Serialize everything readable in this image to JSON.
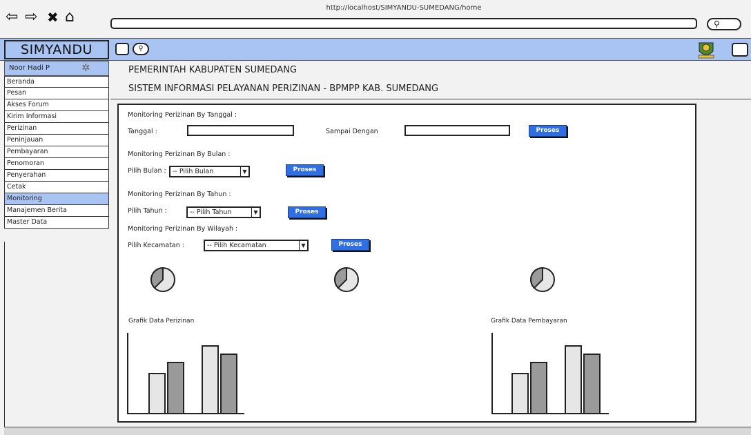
{
  "browser": {
    "url": "http://localhost/SIMYANDU-SUMEDANG/home",
    "back_icon": "arrow-left",
    "forward_icon": "arrow-right",
    "close_glyph": "✖",
    "home_icon": "home"
  },
  "app": {
    "brand": "SIMYANDU",
    "user": "Noor Hadi P",
    "header_line1": "PEMERINTAH KABUPATEN SUMEDANG",
    "header_line2": "SISTEM INFORMASI PELAYANAN PERIZINAN - BPMPP KAB. SUMEDANG",
    "accent_color": "#a9c4f2",
    "button_color": "#2f6ee3"
  },
  "sidebar": {
    "items": [
      {
        "label": "Beranda"
      },
      {
        "label": "Pesan"
      },
      {
        "label": "Akses Forum"
      },
      {
        "label": "Kirim Informasi"
      },
      {
        "label": "Perizinan"
      },
      {
        "label": "Peninjauan"
      },
      {
        "label": "Pembayaran"
      },
      {
        "label": "Penomoran"
      },
      {
        "label": "Penyerahan"
      },
      {
        "label": "Cetak"
      },
      {
        "label": "Monitoring",
        "active": true
      },
      {
        "label": "Manajemen Berita"
      },
      {
        "label": "Master Data"
      }
    ]
  },
  "monitoring": {
    "by_date": {
      "title": "Monitoring Perizinan By Tanggal :",
      "from_label": "Tanggal :",
      "from_value": "",
      "to_label": "Sampai Dengan",
      "to_value": "",
      "button": "Proses"
    },
    "by_month": {
      "title": "Monitoring Perizinan By Bulan :",
      "label": "Pilih Bulan :",
      "selected": "-- Pilih Bulan",
      "button": "Proses"
    },
    "by_year": {
      "title": "Monitoring Perizinan By Tahun :",
      "label": "Pilih Tahun :",
      "selected": "-- Pilih Tahun",
      "button": "Proses"
    },
    "by_region": {
      "title": "Monitoring Perizinan By Wilayah :",
      "label": "Pilih Kecamatan :",
      "selected": "-- Pilih Kecamatan",
      "button": "Proses"
    }
  },
  "charts": {
    "left_title": "Grafik Data Perizinan",
    "right_title": "Grafik Data Pembayaran"
  }
}
